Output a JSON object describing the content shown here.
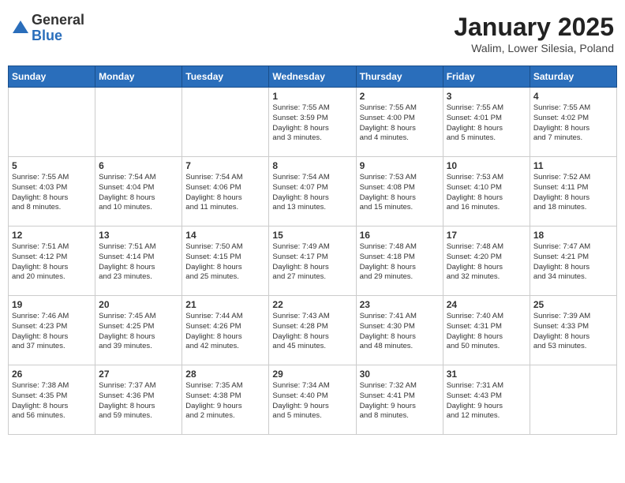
{
  "logo": {
    "general": "General",
    "blue": "Blue"
  },
  "title": "January 2025",
  "subtitle": "Walim, Lower Silesia, Poland",
  "days_of_week": [
    "Sunday",
    "Monday",
    "Tuesday",
    "Wednesday",
    "Thursday",
    "Friday",
    "Saturday"
  ],
  "weeks": [
    [
      {
        "day": "",
        "info": ""
      },
      {
        "day": "",
        "info": ""
      },
      {
        "day": "",
        "info": ""
      },
      {
        "day": "1",
        "info": "Sunrise: 7:55 AM\nSunset: 3:59 PM\nDaylight: 8 hours\nand 3 minutes."
      },
      {
        "day": "2",
        "info": "Sunrise: 7:55 AM\nSunset: 4:00 PM\nDaylight: 8 hours\nand 4 minutes."
      },
      {
        "day": "3",
        "info": "Sunrise: 7:55 AM\nSunset: 4:01 PM\nDaylight: 8 hours\nand 5 minutes."
      },
      {
        "day": "4",
        "info": "Sunrise: 7:55 AM\nSunset: 4:02 PM\nDaylight: 8 hours\nand 7 minutes."
      }
    ],
    [
      {
        "day": "5",
        "info": "Sunrise: 7:55 AM\nSunset: 4:03 PM\nDaylight: 8 hours\nand 8 minutes."
      },
      {
        "day": "6",
        "info": "Sunrise: 7:54 AM\nSunset: 4:04 PM\nDaylight: 8 hours\nand 10 minutes."
      },
      {
        "day": "7",
        "info": "Sunrise: 7:54 AM\nSunset: 4:06 PM\nDaylight: 8 hours\nand 11 minutes."
      },
      {
        "day": "8",
        "info": "Sunrise: 7:54 AM\nSunset: 4:07 PM\nDaylight: 8 hours\nand 13 minutes."
      },
      {
        "day": "9",
        "info": "Sunrise: 7:53 AM\nSunset: 4:08 PM\nDaylight: 8 hours\nand 15 minutes."
      },
      {
        "day": "10",
        "info": "Sunrise: 7:53 AM\nSunset: 4:10 PM\nDaylight: 8 hours\nand 16 minutes."
      },
      {
        "day": "11",
        "info": "Sunrise: 7:52 AM\nSunset: 4:11 PM\nDaylight: 8 hours\nand 18 minutes."
      }
    ],
    [
      {
        "day": "12",
        "info": "Sunrise: 7:51 AM\nSunset: 4:12 PM\nDaylight: 8 hours\nand 20 minutes."
      },
      {
        "day": "13",
        "info": "Sunrise: 7:51 AM\nSunset: 4:14 PM\nDaylight: 8 hours\nand 23 minutes."
      },
      {
        "day": "14",
        "info": "Sunrise: 7:50 AM\nSunset: 4:15 PM\nDaylight: 8 hours\nand 25 minutes."
      },
      {
        "day": "15",
        "info": "Sunrise: 7:49 AM\nSunset: 4:17 PM\nDaylight: 8 hours\nand 27 minutes."
      },
      {
        "day": "16",
        "info": "Sunrise: 7:48 AM\nSunset: 4:18 PM\nDaylight: 8 hours\nand 29 minutes."
      },
      {
        "day": "17",
        "info": "Sunrise: 7:48 AM\nSunset: 4:20 PM\nDaylight: 8 hours\nand 32 minutes."
      },
      {
        "day": "18",
        "info": "Sunrise: 7:47 AM\nSunset: 4:21 PM\nDaylight: 8 hours\nand 34 minutes."
      }
    ],
    [
      {
        "day": "19",
        "info": "Sunrise: 7:46 AM\nSunset: 4:23 PM\nDaylight: 8 hours\nand 37 minutes."
      },
      {
        "day": "20",
        "info": "Sunrise: 7:45 AM\nSunset: 4:25 PM\nDaylight: 8 hours\nand 39 minutes."
      },
      {
        "day": "21",
        "info": "Sunrise: 7:44 AM\nSunset: 4:26 PM\nDaylight: 8 hours\nand 42 minutes."
      },
      {
        "day": "22",
        "info": "Sunrise: 7:43 AM\nSunset: 4:28 PM\nDaylight: 8 hours\nand 45 minutes."
      },
      {
        "day": "23",
        "info": "Sunrise: 7:41 AM\nSunset: 4:30 PM\nDaylight: 8 hours\nand 48 minutes."
      },
      {
        "day": "24",
        "info": "Sunrise: 7:40 AM\nSunset: 4:31 PM\nDaylight: 8 hours\nand 50 minutes."
      },
      {
        "day": "25",
        "info": "Sunrise: 7:39 AM\nSunset: 4:33 PM\nDaylight: 8 hours\nand 53 minutes."
      }
    ],
    [
      {
        "day": "26",
        "info": "Sunrise: 7:38 AM\nSunset: 4:35 PM\nDaylight: 8 hours\nand 56 minutes."
      },
      {
        "day": "27",
        "info": "Sunrise: 7:37 AM\nSunset: 4:36 PM\nDaylight: 8 hours\nand 59 minutes."
      },
      {
        "day": "28",
        "info": "Sunrise: 7:35 AM\nSunset: 4:38 PM\nDaylight: 9 hours\nand 2 minutes."
      },
      {
        "day": "29",
        "info": "Sunrise: 7:34 AM\nSunset: 4:40 PM\nDaylight: 9 hours\nand 5 minutes."
      },
      {
        "day": "30",
        "info": "Sunrise: 7:32 AM\nSunset: 4:41 PM\nDaylight: 9 hours\nand 8 minutes."
      },
      {
        "day": "31",
        "info": "Sunrise: 7:31 AM\nSunset: 4:43 PM\nDaylight: 9 hours\nand 12 minutes."
      },
      {
        "day": "",
        "info": ""
      }
    ]
  ]
}
